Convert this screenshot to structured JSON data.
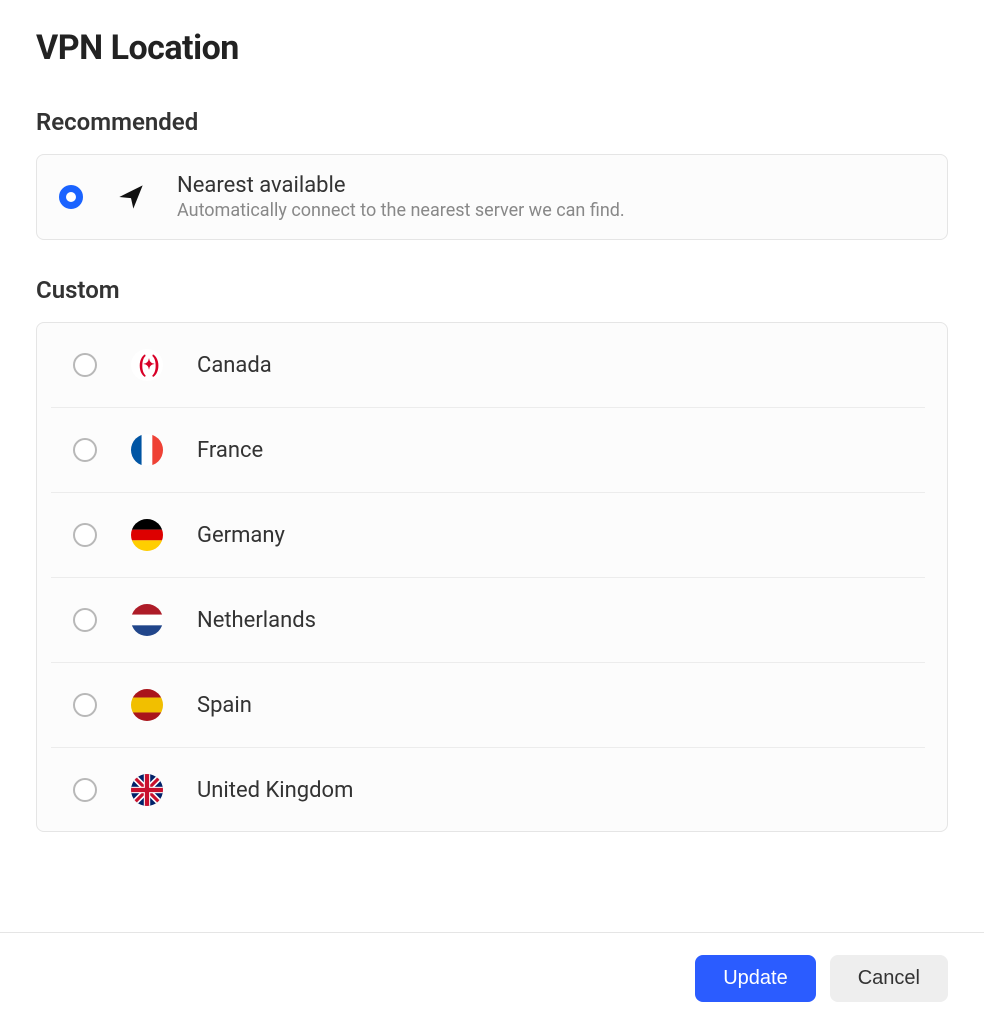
{
  "title": "VPN Location",
  "recommended": {
    "heading": "Recommended",
    "item": {
      "label": "Nearest available",
      "description": "Automatically connect to the nearest server we can find.",
      "selected": true
    }
  },
  "custom": {
    "heading": "Custom",
    "countries": [
      {
        "name": "Canada",
        "code": "ca",
        "selected": false
      },
      {
        "name": "France",
        "code": "fr",
        "selected": false
      },
      {
        "name": "Germany",
        "code": "de",
        "selected": false
      },
      {
        "name": "Netherlands",
        "code": "nl",
        "selected": false
      },
      {
        "name": "Spain",
        "code": "es",
        "selected": false
      },
      {
        "name": "United Kingdom",
        "code": "gb",
        "selected": false
      }
    ]
  },
  "actions": {
    "update": "Update",
    "cancel": "Cancel"
  },
  "colors": {
    "accent": "#2b5cff"
  }
}
